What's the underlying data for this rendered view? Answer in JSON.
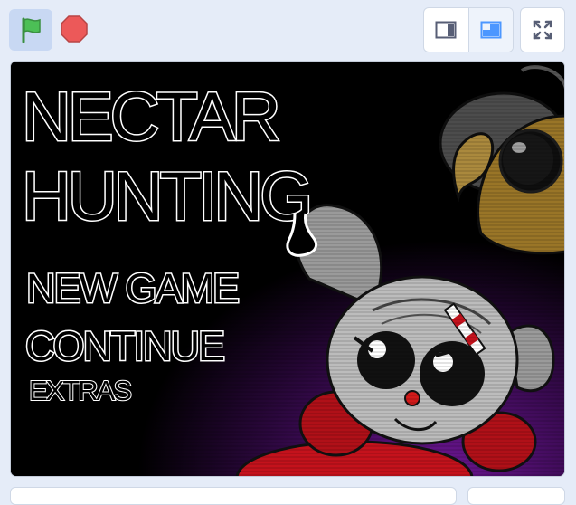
{
  "controls": {
    "green_flag": "green-flag-icon",
    "stop": "stop-icon",
    "small_stage": "small-stage-icon",
    "normal_stage": "normal-stage-icon",
    "fullscreen": "fullscreen-icon"
  },
  "game": {
    "title_line1": "NECTAR",
    "title_line2": "HUNTING",
    "menu": {
      "new_game": "NEW GAME",
      "continue": "CONTINUE",
      "extras": "EXTRAS"
    }
  },
  "colors": {
    "flag_green": "#4cbf56",
    "stop_red": "#ec5959",
    "accent_blue": "#4c97ff",
    "background_purple": "#3a0a52"
  }
}
